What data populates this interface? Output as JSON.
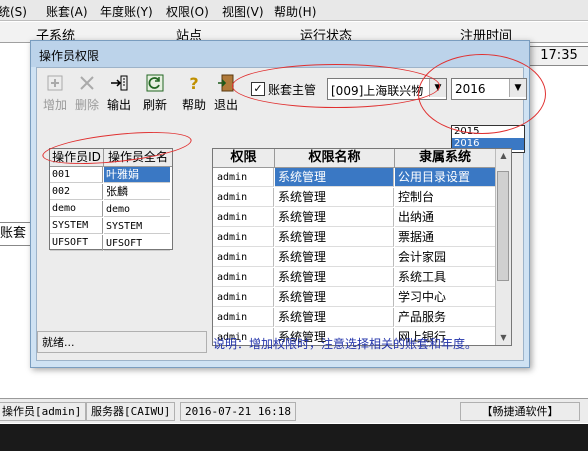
{
  "background_window": {
    "menu": [
      "统(S)",
      "账套(A)",
      "年度账(Y)",
      "权限(O)",
      "视图(V)",
      "帮助(H)"
    ],
    "header_columns": [
      "子系统",
      "站点",
      "运行状态",
      "注册时间"
    ],
    "time_text": "17:35",
    "side_label": "账套",
    "status_bar": {
      "operator": "操作员[admin]",
      "server": "服务器[CAIWU]",
      "datetime": "2016-07-21 16:18",
      "brand": "【畅捷通软件】"
    }
  },
  "dialog": {
    "title": "操作员权限",
    "toolbar": {
      "add": "增加",
      "delete": "删除",
      "export": "输出",
      "refresh": "刷新",
      "help": "帮助",
      "exit": "退出"
    },
    "account_master_label": "账套主管",
    "account_master_checked": true,
    "account_select_value": "[009]上海联兴物",
    "year_select_value": "2016",
    "year_options": [
      "2015",
      "2016"
    ],
    "year_highlighted": "2016",
    "operators": {
      "headers": [
        "操作员ID",
        "操作员全名"
      ],
      "rows": [
        {
          "id": "001",
          "name": "叶雅娟",
          "selected": true
        },
        {
          "id": "002",
          "name": "张麟",
          "selected": false
        },
        {
          "id": "demo",
          "name": "demo",
          "selected": false
        },
        {
          "id": "SYSTEM",
          "name": "SYSTEM",
          "selected": false
        },
        {
          "id": "UFSOFT",
          "name": "UFSOFT",
          "selected": false
        }
      ]
    },
    "permissions": {
      "headers": [
        "权限",
        "权限名称",
        "隶属系统"
      ],
      "rows": [
        {
          "perm": "admin",
          "name": "系统管理",
          "system": "公用目录设置",
          "selected": true
        },
        {
          "perm": "admin",
          "name": "系统管理",
          "system": "控制台",
          "selected": false
        },
        {
          "perm": "admin",
          "name": "系统管理",
          "system": "出纳通",
          "selected": false
        },
        {
          "perm": "admin",
          "name": "系统管理",
          "system": "票据通",
          "selected": false
        },
        {
          "perm": "admin",
          "name": "系统管理",
          "system": "会计家园",
          "selected": false
        },
        {
          "perm": "admin",
          "name": "系统管理",
          "system": "系统工具",
          "selected": false
        },
        {
          "perm": "admin",
          "name": "系统管理",
          "system": "学习中心",
          "selected": false
        },
        {
          "perm": "admin",
          "name": "系统管理",
          "system": "产品服务",
          "selected": false
        },
        {
          "perm": "admin",
          "name": "系统管理",
          "system": "网上银行",
          "selected": false
        }
      ]
    },
    "status_text": "就绪...",
    "note": "说明：增加权限时，注意选择相关的账套和年度。"
  },
  "colors": {
    "dialog_frame": "#cfe2f3",
    "selection": "#3a78c4",
    "annotation": "#e03030",
    "note_text": "#2233aa"
  }
}
